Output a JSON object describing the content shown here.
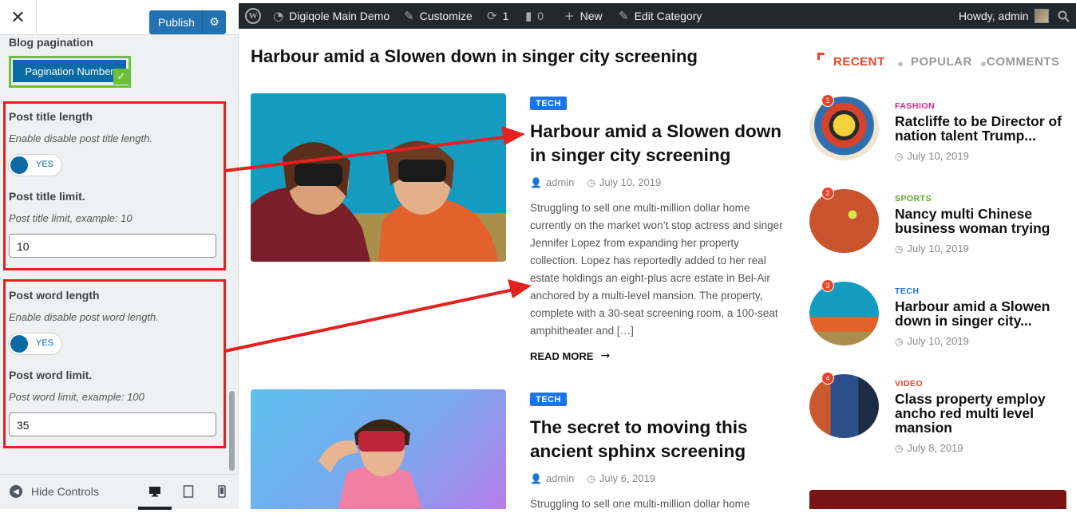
{
  "customizer": {
    "close_glyph": "✕",
    "publish_label": "Publish",
    "publish_settings_icon": "gear-icon",
    "section_heading": "Blog pagination",
    "pagination_button": "Pagination Number",
    "title_length": {
      "label": "Post title length",
      "description": "Enable disable post title length.",
      "toggle_state": "YES",
      "limit_label": "Post title limit.",
      "limit_description": "Post title limit, example: 10",
      "limit_value": "10"
    },
    "word_length": {
      "label": "Post word length",
      "description": "Enable disable post word length.",
      "toggle_state": "YES",
      "limit_label": "Post word limit.",
      "limit_description": "Post word limit, example: 100",
      "limit_value": "35"
    },
    "footer": {
      "hide_controls": "Hide Controls",
      "devices": [
        "desktop-icon",
        "tablet-icon",
        "mobile-icon"
      ],
      "active_device": "desktop"
    }
  },
  "adminbar": {
    "site_name": "Digiqole Main Demo",
    "customize": "Customize",
    "updates_count": "1",
    "comments_count": "0",
    "new_label": "New",
    "edit_label": "Edit Category",
    "greeting": "Howdy, admin"
  },
  "preview": {
    "page_title": "Harbour amid a Slowen down in singer city screening",
    "posts": [
      {
        "tag": "TECH",
        "title": "Harbour amid a Slowen down in singer city screening",
        "author": "admin",
        "date": "July 10, 2019",
        "excerpt": "Struggling to sell one multi-million dollar home currently on the market won’t stop actress and singer Jennifer Lopez from expanding her property collection. Lopez has reportedly added to her real estate holdings an eight-plus acre estate in Bel-Air anchored by a multi-level mansion. The property, complete with a 30-seat screening room, a 100-seat amphitheater and […]",
        "read_more": "READ MORE"
      },
      {
        "tag": "TECH",
        "title": "The secret to moving this ancient sphinx screening",
        "author": "admin",
        "date": "July 6, 2019",
        "excerpt": "Struggling to sell one multi-million dollar home"
      }
    ],
    "sidebar": {
      "tabs": [
        "RECENT",
        "POPULAR",
        "COMMENTS"
      ],
      "active_tab": "RECENT",
      "items": [
        {
          "num": "1",
          "category": "FASHION",
          "cat_color": "#e5218a",
          "title": "Ratcliffe to be Director of nation talent Trump...",
          "date": "July 10, 2019"
        },
        {
          "num": "2",
          "category": "SPORTS",
          "cat_color": "#5aa51d",
          "title": "Nancy multi Chinese business woman trying",
          "date": "July 10, 2019"
        },
        {
          "num": "3",
          "category": "TECH",
          "cat_color": "#1a73e8",
          "title": "Harbour amid a Slowen down in singer city...",
          "date": "July 10, 2019"
        },
        {
          "num": "4",
          "category": "VIDEO",
          "cat_color": "#e8432b",
          "title": "Class property employ ancho red multi level mansion",
          "date": "July 8, 2019"
        }
      ]
    }
  },
  "colors": {
    "accent_red": "#e8432b",
    "annotation_red": "#e3211f",
    "wp_blue": "#2271b1",
    "tag_blue": "#1a73e8",
    "adminbar_bg": "#23282d"
  }
}
